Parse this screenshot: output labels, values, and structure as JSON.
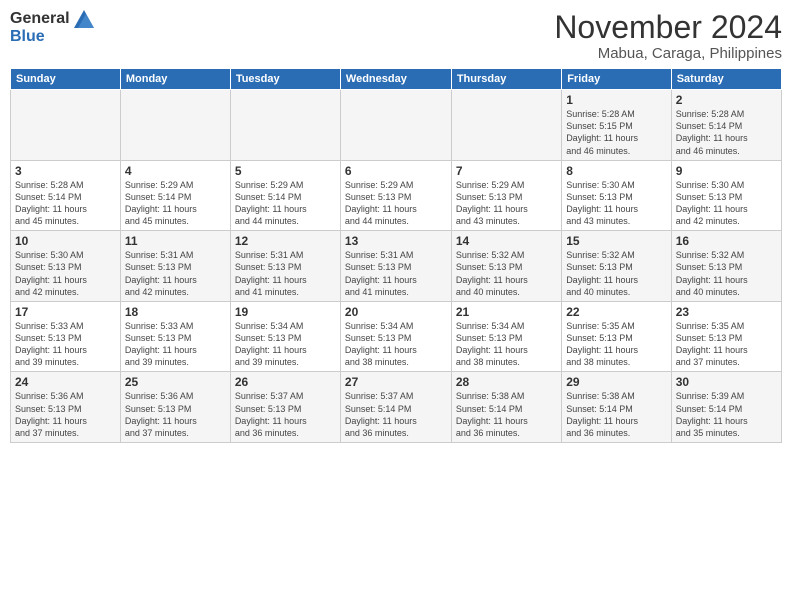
{
  "header": {
    "logo_general": "General",
    "logo_blue": "Blue",
    "title": "November 2024",
    "subtitle": "Mabua, Caraga, Philippines"
  },
  "calendar": {
    "weekdays": [
      "Sunday",
      "Monday",
      "Tuesday",
      "Wednesday",
      "Thursday",
      "Friday",
      "Saturday"
    ],
    "weeks": [
      [
        {
          "day": "",
          "info": ""
        },
        {
          "day": "",
          "info": ""
        },
        {
          "day": "",
          "info": ""
        },
        {
          "day": "",
          "info": ""
        },
        {
          "day": "",
          "info": ""
        },
        {
          "day": "1",
          "info": "Sunrise: 5:28 AM\nSunset: 5:15 PM\nDaylight: 11 hours\nand 46 minutes."
        },
        {
          "day": "2",
          "info": "Sunrise: 5:28 AM\nSunset: 5:14 PM\nDaylight: 11 hours\nand 46 minutes."
        }
      ],
      [
        {
          "day": "3",
          "info": "Sunrise: 5:28 AM\nSunset: 5:14 PM\nDaylight: 11 hours\nand 45 minutes."
        },
        {
          "day": "4",
          "info": "Sunrise: 5:29 AM\nSunset: 5:14 PM\nDaylight: 11 hours\nand 45 minutes."
        },
        {
          "day": "5",
          "info": "Sunrise: 5:29 AM\nSunset: 5:14 PM\nDaylight: 11 hours\nand 44 minutes."
        },
        {
          "day": "6",
          "info": "Sunrise: 5:29 AM\nSunset: 5:13 PM\nDaylight: 11 hours\nand 44 minutes."
        },
        {
          "day": "7",
          "info": "Sunrise: 5:29 AM\nSunset: 5:13 PM\nDaylight: 11 hours\nand 43 minutes."
        },
        {
          "day": "8",
          "info": "Sunrise: 5:30 AM\nSunset: 5:13 PM\nDaylight: 11 hours\nand 43 minutes."
        },
        {
          "day": "9",
          "info": "Sunrise: 5:30 AM\nSunset: 5:13 PM\nDaylight: 11 hours\nand 42 minutes."
        }
      ],
      [
        {
          "day": "10",
          "info": "Sunrise: 5:30 AM\nSunset: 5:13 PM\nDaylight: 11 hours\nand 42 minutes."
        },
        {
          "day": "11",
          "info": "Sunrise: 5:31 AM\nSunset: 5:13 PM\nDaylight: 11 hours\nand 42 minutes."
        },
        {
          "day": "12",
          "info": "Sunrise: 5:31 AM\nSunset: 5:13 PM\nDaylight: 11 hours\nand 41 minutes."
        },
        {
          "day": "13",
          "info": "Sunrise: 5:31 AM\nSunset: 5:13 PM\nDaylight: 11 hours\nand 41 minutes."
        },
        {
          "day": "14",
          "info": "Sunrise: 5:32 AM\nSunset: 5:13 PM\nDaylight: 11 hours\nand 40 minutes."
        },
        {
          "day": "15",
          "info": "Sunrise: 5:32 AM\nSunset: 5:13 PM\nDaylight: 11 hours\nand 40 minutes."
        },
        {
          "day": "16",
          "info": "Sunrise: 5:32 AM\nSunset: 5:13 PM\nDaylight: 11 hours\nand 40 minutes."
        }
      ],
      [
        {
          "day": "17",
          "info": "Sunrise: 5:33 AM\nSunset: 5:13 PM\nDaylight: 11 hours\nand 39 minutes."
        },
        {
          "day": "18",
          "info": "Sunrise: 5:33 AM\nSunset: 5:13 PM\nDaylight: 11 hours\nand 39 minutes."
        },
        {
          "day": "19",
          "info": "Sunrise: 5:34 AM\nSunset: 5:13 PM\nDaylight: 11 hours\nand 39 minutes."
        },
        {
          "day": "20",
          "info": "Sunrise: 5:34 AM\nSunset: 5:13 PM\nDaylight: 11 hours\nand 38 minutes."
        },
        {
          "day": "21",
          "info": "Sunrise: 5:34 AM\nSunset: 5:13 PM\nDaylight: 11 hours\nand 38 minutes."
        },
        {
          "day": "22",
          "info": "Sunrise: 5:35 AM\nSunset: 5:13 PM\nDaylight: 11 hours\nand 38 minutes."
        },
        {
          "day": "23",
          "info": "Sunrise: 5:35 AM\nSunset: 5:13 PM\nDaylight: 11 hours\nand 37 minutes."
        }
      ],
      [
        {
          "day": "24",
          "info": "Sunrise: 5:36 AM\nSunset: 5:13 PM\nDaylight: 11 hours\nand 37 minutes."
        },
        {
          "day": "25",
          "info": "Sunrise: 5:36 AM\nSunset: 5:13 PM\nDaylight: 11 hours\nand 37 minutes."
        },
        {
          "day": "26",
          "info": "Sunrise: 5:37 AM\nSunset: 5:13 PM\nDaylight: 11 hours\nand 36 minutes."
        },
        {
          "day": "27",
          "info": "Sunrise: 5:37 AM\nSunset: 5:14 PM\nDaylight: 11 hours\nand 36 minutes."
        },
        {
          "day": "28",
          "info": "Sunrise: 5:38 AM\nSunset: 5:14 PM\nDaylight: 11 hours\nand 36 minutes."
        },
        {
          "day": "29",
          "info": "Sunrise: 5:38 AM\nSunset: 5:14 PM\nDaylight: 11 hours\nand 36 minutes."
        },
        {
          "day": "30",
          "info": "Sunrise: 5:39 AM\nSunset: 5:14 PM\nDaylight: 11 hours\nand 35 minutes."
        }
      ]
    ]
  }
}
